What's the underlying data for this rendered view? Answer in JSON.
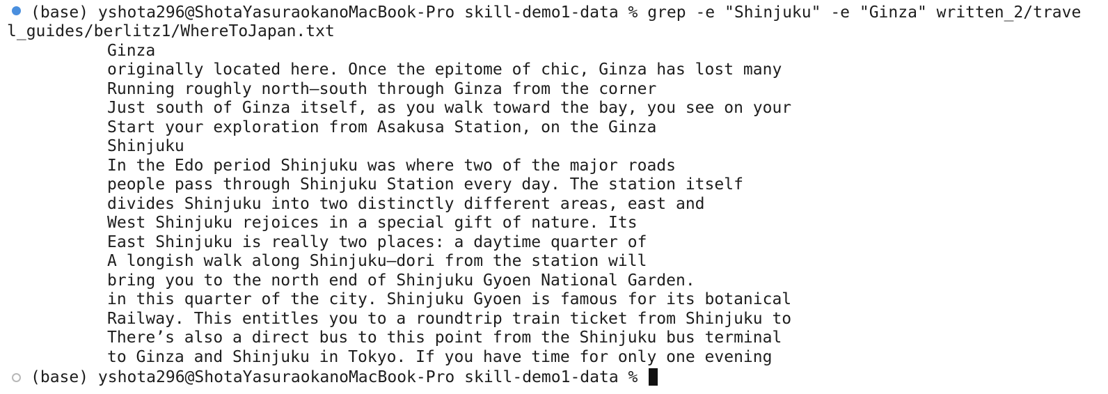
{
  "terminal": {
    "command_prompt": "(base) yshota296@ShotaYasuraokanoMacBook-Pro skill-demo1-data % grep -e \"Shinjuku\" -e \"Ginza\" written_2/trave",
    "command_wrap": "l_guides/berlitz1/WhereToJapan.txt",
    "output": [
      "Ginza",
      "originally located here. Once the epitome of chic, Ginza has lost many",
      "Running roughly north–south through Ginza from the corner",
      "Just south of Ginza itself, as you walk toward the bay, you see on your",
      "Start your exploration from Asakusa Station, on the Ginza",
      "Shinjuku",
      "In the Edo period Shinjuku was where two of the major roads",
      "people pass through Shinjuku Station every day. The station itself",
      "divides Shinjuku into two distinctly different areas, east and",
      "West Shinjuku rejoices in a special gift of nature. Its",
      "East Shinjuku is really two places: a daytime quarter of",
      "A longish walk along Shinjuku–dori from the station will",
      "bring you to the north end of Shinjuku Gyoen National Garden.",
      "in this quarter of the city. Shinjuku Gyoen is famous for its botanical",
      "Railway. This entitles you to a roundtrip train ticket from Shinjuku to",
      "There’s also a direct bus to this point from the Shinjuku bus terminal",
      "to Ginza and Shinjuku in Tokyo. If you have time for only one evening"
    ],
    "final_prompt": "(base) yshota296@ShotaYasuraokanoMacBook-Pro skill-demo1-data % ",
    "colors": {
      "finished_marker": "#4a8fde",
      "pending_marker": "#b8b8b8",
      "text": "#1d1d1d",
      "background": "#ffffff"
    }
  }
}
